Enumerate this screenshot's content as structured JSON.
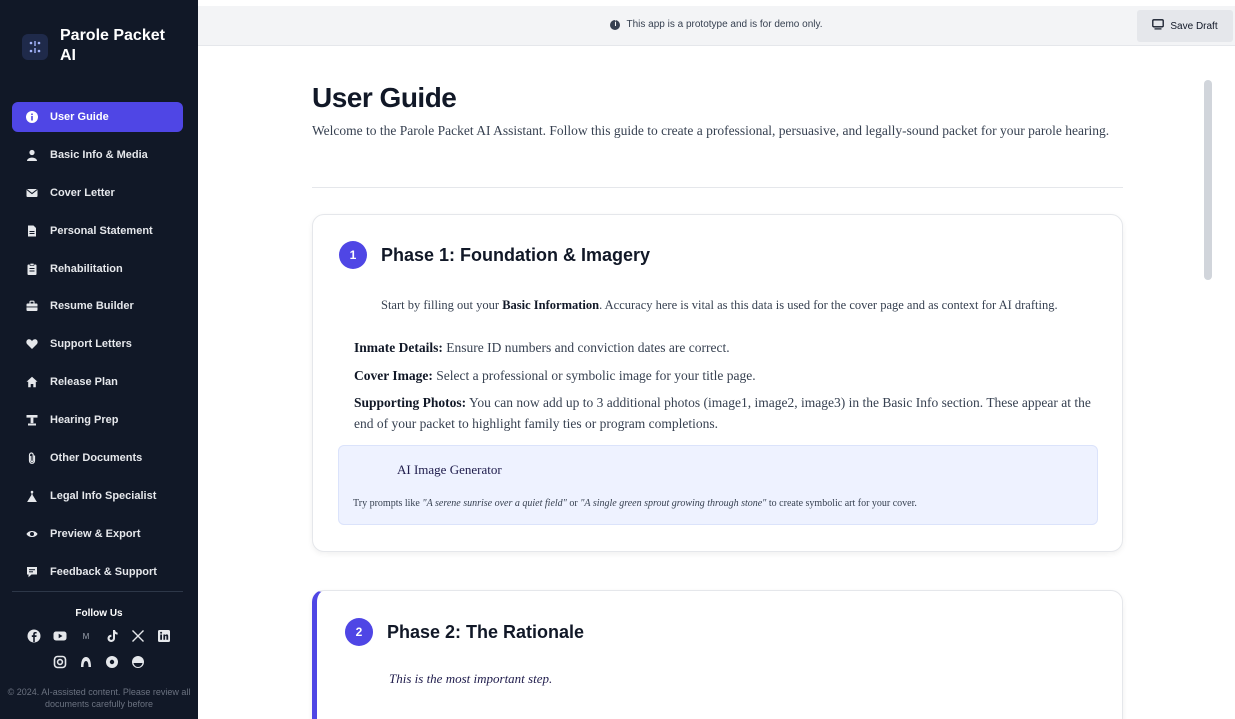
{
  "brand": {
    "title": "Parole Packet AI"
  },
  "sidebar": {
    "items": [
      {
        "label": "User Guide",
        "icon": "info-icon",
        "active": true
      },
      {
        "label": "Basic Info & Media",
        "icon": "user-icon"
      },
      {
        "label": "Cover Letter",
        "icon": "envelope-icon"
      },
      {
        "label": "Personal Statement",
        "icon": "file-icon"
      },
      {
        "label": "Rehabilitation",
        "icon": "clipboard-icon"
      },
      {
        "label": "Resume Builder",
        "icon": "briefcase-icon"
      },
      {
        "label": "Support Letters",
        "icon": "heart-icon"
      },
      {
        "label": "Release Plan",
        "icon": "home-icon"
      },
      {
        "label": "Hearing Prep",
        "icon": "gavel-icon"
      },
      {
        "label": "Other Documents",
        "icon": "paperclip-icon"
      },
      {
        "label": "Legal Info Specialist",
        "icon": "scales-icon"
      },
      {
        "label": "Preview & Export",
        "icon": "eye-icon"
      },
      {
        "label": "Feedback & Support",
        "icon": "comment-icon"
      }
    ],
    "follow_label": "Follow Us",
    "copyright": "© 2024. AI-assisted content. Please review all documents carefully before"
  },
  "topbar": {
    "notice": "This app is a prototype and is for demo only.",
    "save_label": "Save Draft"
  },
  "main": {
    "title": "User Guide",
    "intro": "Welcome to the Parole Packet AI Assistant. Follow this guide to create a professional, persuasive, and legally-sound packet for your parole hearing.",
    "phase1": {
      "number": "1",
      "title": "Phase 1: Foundation & Imagery",
      "p_start": "Start by filling out your ",
      "p_bold": "Basic Information",
      "p_end": ". Accuracy here is vital as this data is used for the cover page and as context for AI drafting.",
      "details": [
        {
          "label": "Inmate Details:",
          "text": " Ensure ID numbers and conviction dates are correct."
        },
        {
          "label": "Cover Image:",
          "text": " Select a professional or symbolic image for your title page."
        },
        {
          "label": "Supporting Photos:",
          "text": " You can now add up to 3 additional photos (image1, image2, image3) in the Basic Info section. These appear at the end of your packet to highlight family ties or program completions."
        }
      ],
      "ai_title": "AI Image Generator",
      "ai_text_1": "Try prompts like ",
      "ai_example_1": "\"A serene sunrise over a quiet field\"",
      "ai_text_2": " or ",
      "ai_example_2": "\"A single green sprout growing through stone\"",
      "ai_text_3": " to create symbolic art for your cover."
    },
    "phase2": {
      "number": "2",
      "title": "Phase 2: The Rationale",
      "subtitle": "This is the most important step."
    }
  },
  "colors": {
    "accent": "#4f46e5",
    "sidebar_bg": "#111827",
    "ai_box_bg": "#eef2ff"
  }
}
